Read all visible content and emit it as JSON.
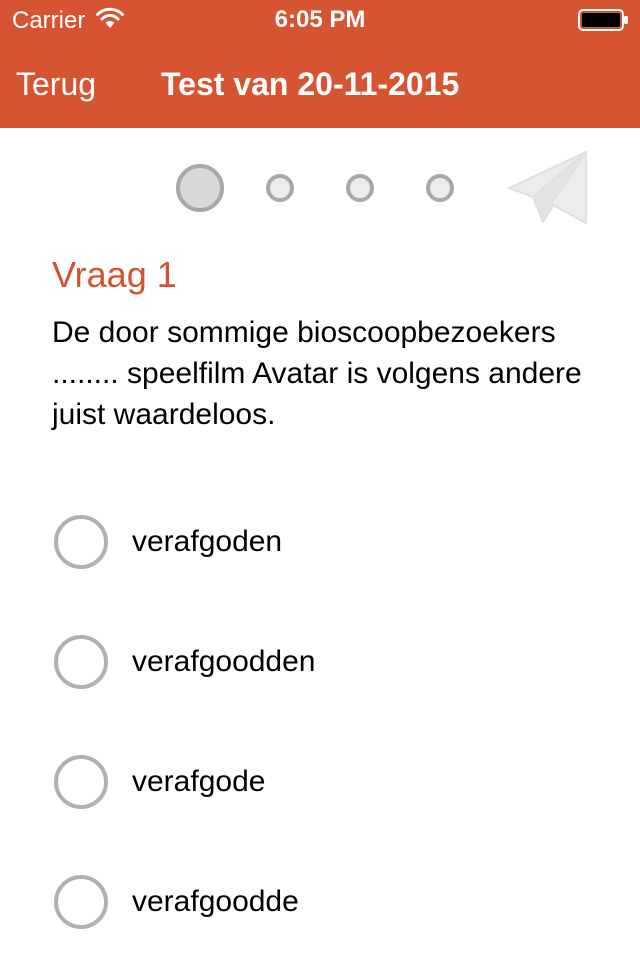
{
  "status_bar": {
    "carrier": "Carrier",
    "time": "6:05 PM",
    "wifi_icon": "wifi-icon",
    "battery_icon": "battery-icon"
  },
  "nav": {
    "back_label": "Terug",
    "title": "Test van 20-11-2015"
  },
  "progress": {
    "total_questions": 4,
    "current_question": 1,
    "send_icon": "paper-plane-icon"
  },
  "question": {
    "label": "Vraag 1",
    "text": "De door sommige bioscoopbezoekers ........ speelfilm Avatar is volgens andere juist waardeloos."
  },
  "options": [
    {
      "label": "verafgoden"
    },
    {
      "label": "verafgoodden"
    },
    {
      "label": "verafgode"
    },
    {
      "label": "verafgoodde"
    }
  ],
  "colors": {
    "accent": "#d65432",
    "question_label": "#d4522f",
    "radio_border": "#b0b0b0"
  }
}
